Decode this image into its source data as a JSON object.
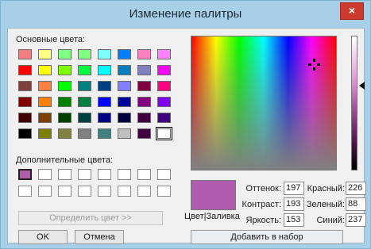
{
  "title": "Изменение палитры",
  "close_glyph": "×",
  "basic_colors_label": "Основные цвета:",
  "basic_colors": [
    "#f08080",
    "#ffff80",
    "#80ff80",
    "#80ff80",
    "#80ffff",
    "#0080ff",
    "#ff80c0",
    "#ff80ff",
    "#ff0000",
    "#ffff00",
    "#80ff00",
    "#00ff40",
    "#00ffff",
    "#0080c0",
    "#8080c0",
    "#ff00ff",
    "#804040",
    "#ff8040",
    "#00ff00",
    "#008080",
    "#004080",
    "#8080ff",
    "#800040",
    "#ff0080",
    "#800000",
    "#ff8000",
    "#008000",
    "#008040",
    "#0000ff",
    "#0000a0",
    "#800080",
    "#8000ff",
    "#400000",
    "#804000",
    "#004000",
    "#004040",
    "#000080",
    "#000040",
    "#400040",
    "#400080",
    "#000000",
    "#808000",
    "#808040",
    "#808080",
    "#408080",
    "#c0c0c0",
    "#400040",
    "#ffffff"
  ],
  "selected_basic_index": 47,
  "custom_colors_label": "Дополнительные цвета:",
  "custom_colors": [
    "#b05ab0",
    "#ffffff",
    "#ffffff",
    "#ffffff",
    "#ffffff",
    "#ffffff",
    "#ffffff",
    "#ffffff",
    "#ffffff",
    "#ffffff",
    "#ffffff",
    "#ffffff",
    "#ffffff",
    "#ffffff",
    "#ffffff",
    "#ffffff"
  ],
  "buttons": {
    "define": "Определить цвет >>",
    "ok": "OK",
    "cancel": "Отмена",
    "add": "Добавить в набор"
  },
  "preview_color": "#b05ab0",
  "color_fill_label": "Цвет|Заливка",
  "fields": {
    "hue_label": "Оттенок:",
    "hue": "197",
    "sat_label": "Контраст:",
    "sat": "193",
    "lum_label": "Яркость:",
    "lum": "153",
    "red_label": "Красный:",
    "red": "226",
    "green_label": "Зеленый:",
    "green": "88",
    "blue_label": "Синий:",
    "blue": "237"
  }
}
